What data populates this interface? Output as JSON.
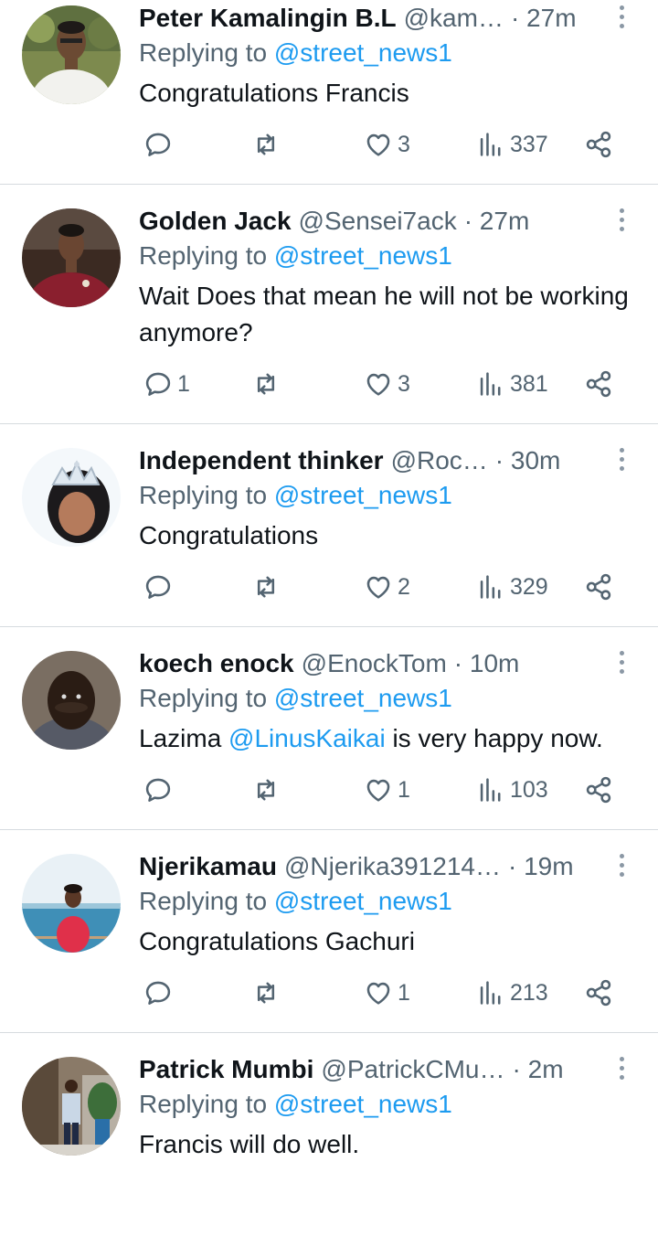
{
  "replying_to_label": "Replying to",
  "replies": [
    {
      "name": "Peter Kamalingin B.L",
      "handle": "@kam…",
      "time": "· 27m",
      "replying_to": "@street_news1",
      "text": "Congratulations Francis",
      "counts": {
        "replies": "",
        "retweets": "",
        "likes": "3",
        "views": "337"
      }
    },
    {
      "name": "Golden Jack",
      "handle": "@Sensei7ack",
      "time": "· 27m",
      "replying_to": "@street_news1",
      "text": "Wait Does that mean he will not be working anymore?",
      "counts": {
        "replies": "1",
        "retweets": "",
        "likes": "3",
        "views": "381"
      }
    },
    {
      "name": "Independent thinker",
      "handle": "@Roc…",
      "time": "· 30m",
      "replying_to": "@street_news1",
      "text": "Congratulations",
      "counts": {
        "replies": "",
        "retweets": "",
        "likes": "2",
        "views": "329"
      }
    },
    {
      "name": "koech enock",
      "handle": "@EnockTom",
      "time": "· 10m",
      "replying_to": "@street_news1",
      "text_before": "Lazima ",
      "text_mention": "@LinusKaikai",
      "text_after": " is very happy now.",
      "counts": {
        "replies": "",
        "retweets": "",
        "likes": "1",
        "views": "103"
      }
    },
    {
      "name": "Njerikamau",
      "handle": "@Njerika391214…",
      "time": "· 19m",
      "replying_to": "@street_news1",
      "text": "Congratulations Gachuri",
      "counts": {
        "replies": "",
        "retweets": "",
        "likes": "1",
        "views": "213"
      }
    },
    {
      "name": "Patrick Mumbi",
      "handle": "@PatrickCMu…",
      "time": "· 2m",
      "replying_to": "@street_news1",
      "text": "Francis will do well.",
      "counts": {
        "replies": "",
        "retweets": "",
        "likes": "",
        "views": ""
      }
    }
  ],
  "icons": {
    "reply": "speech-bubble-icon",
    "retweet": "retweet-arrows-icon",
    "like": "heart-outline-icon",
    "views": "bar-chart-icon",
    "share": "share-nodes-icon",
    "more": "vertical-dots-icon"
  },
  "colors": {
    "text": "#0f1419",
    "secondary": "#536471",
    "link": "#1d9bf0",
    "divider": "#d6dbdf"
  }
}
